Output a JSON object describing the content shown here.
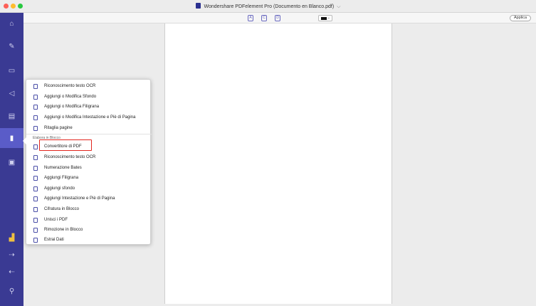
{
  "window": {
    "title": "Wondershare PDFelement Pro (Documento en Blanco.pdf)",
    "title_chevron": "⌵"
  },
  "sidebar": {
    "items": [
      {
        "icon": "home-icon",
        "glyph": "⌂"
      },
      {
        "icon": "edit-icon",
        "glyph": "✎"
      },
      {
        "icon": "comment-icon",
        "glyph": "▭"
      },
      {
        "icon": "send-icon",
        "glyph": "◁"
      },
      {
        "icon": "form-icon",
        "glyph": "▤"
      },
      {
        "icon": "tools-icon",
        "glyph": "▮"
      },
      {
        "icon": "image-icon",
        "glyph": "▣"
      }
    ],
    "bottom": [
      {
        "icon": "chart-icon",
        "glyph": "▟"
      },
      {
        "icon": "collapse-icon",
        "glyph": "⇢"
      },
      {
        "icon": "back-icon",
        "glyph": "⇠"
      },
      {
        "icon": "account-icon",
        "glyph": "⚲"
      }
    ],
    "active_index": 5
  },
  "toolbar": {
    "icons": [
      {
        "name": "ocr-tool-icon",
        "glyph": "A"
      },
      {
        "name": "convert-tool-icon",
        "glyph": "C"
      },
      {
        "name": "document-tool-icon",
        "glyph": "D"
      }
    ],
    "color_dropdown": "⌄",
    "apply_label": "Applica"
  },
  "menu": {
    "top_items": [
      {
        "label": "Riconoscimento testo OCR",
        "icon": "ocr-icon"
      },
      {
        "label": "Aggiungi o Modifica Sfondo",
        "icon": "background-icon"
      },
      {
        "label": "Aggiungi o Modifica Filigrana",
        "icon": "watermark-icon"
      },
      {
        "label": "Aggiungi o Modifica Intestazione e Piè di Pagina",
        "icon": "header-footer-icon"
      },
      {
        "label": "Ritaglia pagine",
        "icon": "crop-icon"
      }
    ],
    "section_label": "Elabora in Blocco",
    "batch_items": [
      {
        "label": "Convertitore di PDF",
        "icon": "convert-icon"
      },
      {
        "label": "Riconoscimento testo OCR",
        "icon": "ocr-icon"
      },
      {
        "label": "Numerazione Bates",
        "icon": "bates-icon"
      },
      {
        "label": "Aggiungi Filigrana",
        "icon": "watermark-icon"
      },
      {
        "label": "Aggiungi sfondo",
        "icon": "background-icon"
      },
      {
        "label": "Aggiungi Intestazione e Piè di Pagina",
        "icon": "header-footer-icon"
      },
      {
        "label": "Cifratura in Blocco",
        "icon": "lock-icon"
      },
      {
        "label": "Unisci i PDF",
        "icon": "merge-icon"
      },
      {
        "label": "Rimozione in Blocco",
        "icon": "trash-icon"
      },
      {
        "label": "Estrai Dati",
        "icon": "extract-icon"
      }
    ]
  },
  "colors": {
    "sidebar": "#3a3a93",
    "sidebar_active": "#5a5cc8",
    "highlight": "#e2261e",
    "icon_accent": "#4b4fa8"
  }
}
